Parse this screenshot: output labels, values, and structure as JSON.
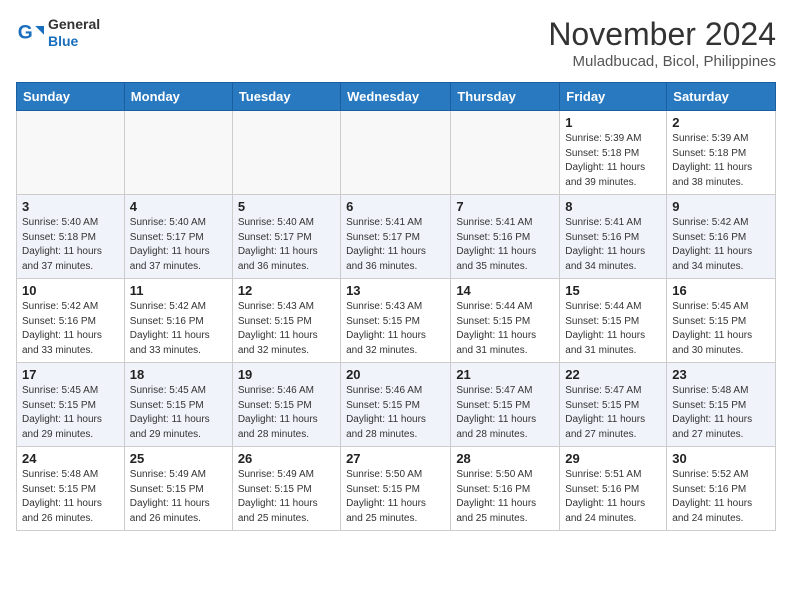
{
  "header": {
    "logo_general": "General",
    "logo_blue": "Blue",
    "month_title": "November 2024",
    "location": "Muladbucad, Bicol, Philippines"
  },
  "weekdays": [
    "Sunday",
    "Monday",
    "Tuesday",
    "Wednesday",
    "Thursday",
    "Friday",
    "Saturday"
  ],
  "weeks": [
    [
      {
        "day": "",
        "info": ""
      },
      {
        "day": "",
        "info": ""
      },
      {
        "day": "",
        "info": ""
      },
      {
        "day": "",
        "info": ""
      },
      {
        "day": "",
        "info": ""
      },
      {
        "day": "1",
        "info": "Sunrise: 5:39 AM\nSunset: 5:18 PM\nDaylight: 11 hours\nand 39 minutes."
      },
      {
        "day": "2",
        "info": "Sunrise: 5:39 AM\nSunset: 5:18 PM\nDaylight: 11 hours\nand 38 minutes."
      }
    ],
    [
      {
        "day": "3",
        "info": "Sunrise: 5:40 AM\nSunset: 5:18 PM\nDaylight: 11 hours\nand 37 minutes."
      },
      {
        "day": "4",
        "info": "Sunrise: 5:40 AM\nSunset: 5:17 PM\nDaylight: 11 hours\nand 37 minutes."
      },
      {
        "day": "5",
        "info": "Sunrise: 5:40 AM\nSunset: 5:17 PM\nDaylight: 11 hours\nand 36 minutes."
      },
      {
        "day": "6",
        "info": "Sunrise: 5:41 AM\nSunset: 5:17 PM\nDaylight: 11 hours\nand 36 minutes."
      },
      {
        "day": "7",
        "info": "Sunrise: 5:41 AM\nSunset: 5:16 PM\nDaylight: 11 hours\nand 35 minutes."
      },
      {
        "day": "8",
        "info": "Sunrise: 5:41 AM\nSunset: 5:16 PM\nDaylight: 11 hours\nand 34 minutes."
      },
      {
        "day": "9",
        "info": "Sunrise: 5:42 AM\nSunset: 5:16 PM\nDaylight: 11 hours\nand 34 minutes."
      }
    ],
    [
      {
        "day": "10",
        "info": "Sunrise: 5:42 AM\nSunset: 5:16 PM\nDaylight: 11 hours\nand 33 minutes."
      },
      {
        "day": "11",
        "info": "Sunrise: 5:42 AM\nSunset: 5:16 PM\nDaylight: 11 hours\nand 33 minutes."
      },
      {
        "day": "12",
        "info": "Sunrise: 5:43 AM\nSunset: 5:15 PM\nDaylight: 11 hours\nand 32 minutes."
      },
      {
        "day": "13",
        "info": "Sunrise: 5:43 AM\nSunset: 5:15 PM\nDaylight: 11 hours\nand 32 minutes."
      },
      {
        "day": "14",
        "info": "Sunrise: 5:44 AM\nSunset: 5:15 PM\nDaylight: 11 hours\nand 31 minutes."
      },
      {
        "day": "15",
        "info": "Sunrise: 5:44 AM\nSunset: 5:15 PM\nDaylight: 11 hours\nand 31 minutes."
      },
      {
        "day": "16",
        "info": "Sunrise: 5:45 AM\nSunset: 5:15 PM\nDaylight: 11 hours\nand 30 minutes."
      }
    ],
    [
      {
        "day": "17",
        "info": "Sunrise: 5:45 AM\nSunset: 5:15 PM\nDaylight: 11 hours\nand 29 minutes."
      },
      {
        "day": "18",
        "info": "Sunrise: 5:45 AM\nSunset: 5:15 PM\nDaylight: 11 hours\nand 29 minutes."
      },
      {
        "day": "19",
        "info": "Sunrise: 5:46 AM\nSunset: 5:15 PM\nDaylight: 11 hours\nand 28 minutes."
      },
      {
        "day": "20",
        "info": "Sunrise: 5:46 AM\nSunset: 5:15 PM\nDaylight: 11 hours\nand 28 minutes."
      },
      {
        "day": "21",
        "info": "Sunrise: 5:47 AM\nSunset: 5:15 PM\nDaylight: 11 hours\nand 28 minutes."
      },
      {
        "day": "22",
        "info": "Sunrise: 5:47 AM\nSunset: 5:15 PM\nDaylight: 11 hours\nand 27 minutes."
      },
      {
        "day": "23",
        "info": "Sunrise: 5:48 AM\nSunset: 5:15 PM\nDaylight: 11 hours\nand 27 minutes."
      }
    ],
    [
      {
        "day": "24",
        "info": "Sunrise: 5:48 AM\nSunset: 5:15 PM\nDaylight: 11 hours\nand 26 minutes."
      },
      {
        "day": "25",
        "info": "Sunrise: 5:49 AM\nSunset: 5:15 PM\nDaylight: 11 hours\nand 26 minutes."
      },
      {
        "day": "26",
        "info": "Sunrise: 5:49 AM\nSunset: 5:15 PM\nDaylight: 11 hours\nand 25 minutes."
      },
      {
        "day": "27",
        "info": "Sunrise: 5:50 AM\nSunset: 5:15 PM\nDaylight: 11 hours\nand 25 minutes."
      },
      {
        "day": "28",
        "info": "Sunrise: 5:50 AM\nSunset: 5:16 PM\nDaylight: 11 hours\nand 25 minutes."
      },
      {
        "day": "29",
        "info": "Sunrise: 5:51 AM\nSunset: 5:16 PM\nDaylight: 11 hours\nand 24 minutes."
      },
      {
        "day": "30",
        "info": "Sunrise: 5:52 AM\nSunset: 5:16 PM\nDaylight: 11 hours\nand 24 minutes."
      }
    ]
  ]
}
